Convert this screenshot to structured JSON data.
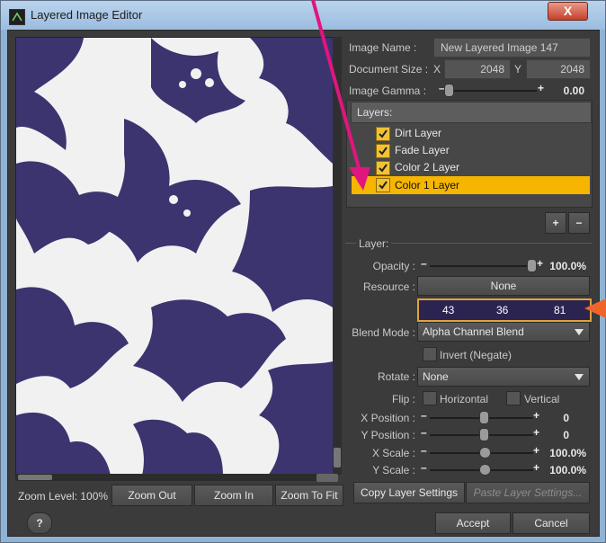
{
  "window": {
    "title": "Layered Image Editor",
    "close_label": "X"
  },
  "preview": {
    "zoom_label": "Zoom Level: 100%",
    "zoom_out_label": "Zoom Out",
    "zoom_in_label": "Zoom In",
    "zoom_fit_label": "Zoom To Fit"
  },
  "image": {
    "name_label": "Image Name :",
    "name_value": "New Layered Image 147",
    "doc_size_label": "Document Size :",
    "x_label": "X",
    "y_label": "Y",
    "doc_width": "2048",
    "doc_height": "2048",
    "gamma_label": "Image Gamma :",
    "gamma_value": "0.00"
  },
  "layers": {
    "header": "Layers:",
    "items": [
      {
        "label": "Dirt Layer",
        "checked": true,
        "selected": false
      },
      {
        "label": "Fade Layer",
        "checked": true,
        "selected": false
      },
      {
        "label": "Color 2 Layer",
        "checked": true,
        "selected": false
      },
      {
        "label": "Color 1 Layer",
        "checked": true,
        "selected": true
      }
    ],
    "add_label": "+",
    "remove_label": "−"
  },
  "layer": {
    "group_label": "Layer:",
    "opacity_label": "Opacity :",
    "opacity_value": "100.0%",
    "resource_label": "Resource :",
    "resource_value": "None",
    "color": {
      "r": "43",
      "g": "36",
      "b": "81",
      "swatch": "#2b2451"
    },
    "blend_label": "Blend Mode :",
    "blend_value": "Alpha Channel Blend",
    "invert_label": "Invert (Negate)",
    "rotate_label": "Rotate :",
    "rotate_value": "None",
    "flip_label": "Flip :",
    "flip_h_label": "Horizontal",
    "flip_v_label": "Vertical",
    "xpos_label": "X Position :",
    "xpos_value": "0",
    "ypos_label": "Y Position :",
    "ypos_value": "0",
    "xscale_label": "X Scale :",
    "xscale_value": "100.0%",
    "yscale_label": "Y Scale :",
    "yscale_value": "100.0%",
    "copy_label": "Copy Layer Settings",
    "paste_label": "Paste Layer Settings..."
  },
  "footer": {
    "help_label": "?",
    "accept_label": "Accept",
    "cancel_label": "Cancel"
  },
  "colors": {
    "selected_row": "#f6b600",
    "checkbox": "#f2c233",
    "pattern_blue": "#3b346f",
    "annotation_magenta": "#e0157f",
    "annotation_orange": "#f0642a"
  }
}
